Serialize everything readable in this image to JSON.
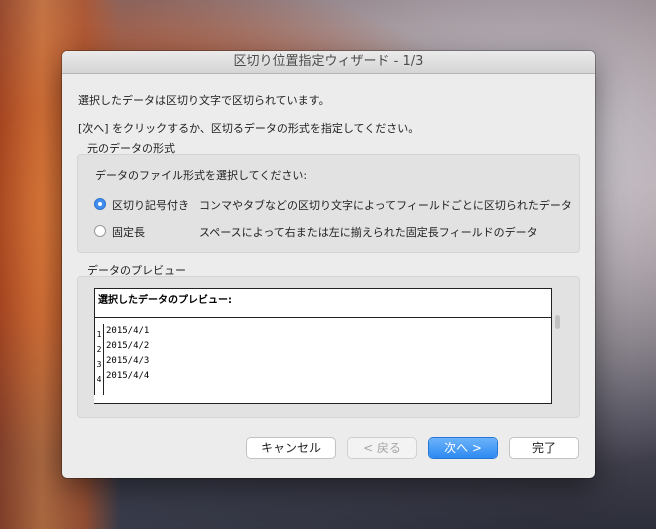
{
  "window": {
    "title": "区切り位置指定ウィザード - 1/3"
  },
  "instructions": {
    "line1": "選択したデータは区切り文字で区切られています。",
    "line2": "[次へ] をクリックするか、区切るデータの形式を指定してください。"
  },
  "format_section": {
    "label": "元のデータの形式",
    "prompt": "データのファイル形式を選択してください:",
    "options": [
      {
        "label": "区切り記号付き",
        "description": "コンマやタブなどの区切り文字によってフィールドごとに区切られたデータ",
        "selected": true
      },
      {
        "label": "固定長",
        "description": "スペースによって右または左に揃えられた固定長フィールドのデータ",
        "selected": false
      }
    ]
  },
  "preview_section": {
    "label": "データのプレビュー",
    "header": "選択したデータのプレビュー:",
    "rows": [
      {
        "num": "1",
        "value": "2015/4/1"
      },
      {
        "num": "2",
        "value": "2015/4/2"
      },
      {
        "num": "3",
        "value": "2015/4/3"
      },
      {
        "num": "4",
        "value": "2015/4/4"
      },
      {
        "num": "",
        "value": ""
      }
    ]
  },
  "buttons": {
    "cancel": "キャンセル",
    "back": "< 戻る",
    "next": "次へ >",
    "finish": "完了"
  },
  "colors": {
    "accent": "#3f8ef0",
    "dialog_bg": "#ececec"
  }
}
